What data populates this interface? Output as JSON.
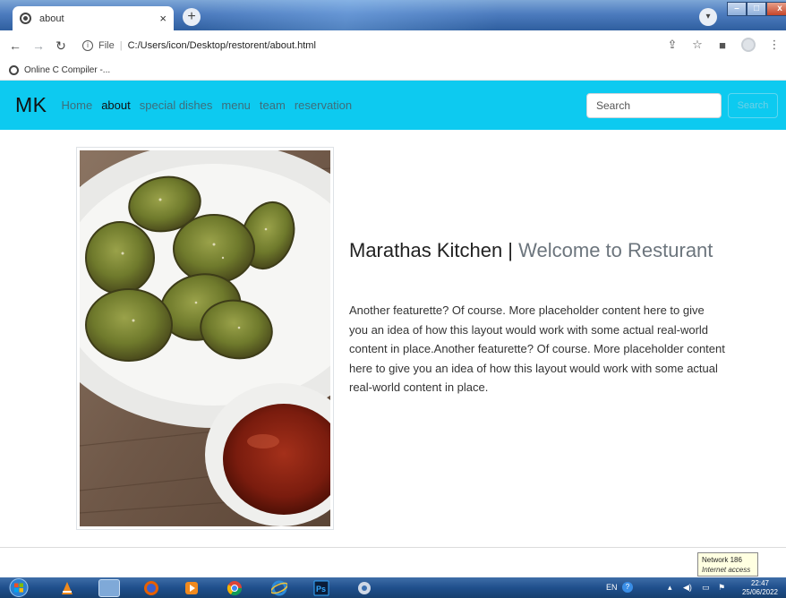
{
  "browser": {
    "tab_title": "about",
    "tab_close": "×",
    "new_tab": "+",
    "url_scheme": "File",
    "url_path": "C:/Users/icon/Desktop/restorent/about.html",
    "bookmark_label": "Online C Compiler -..."
  },
  "navbar": {
    "brand": "MK",
    "links": [
      {
        "label": "Home",
        "active": false
      },
      {
        "label": "about",
        "active": true
      },
      {
        "label": "special dishes",
        "active": false
      },
      {
        "label": "menu",
        "active": false
      },
      {
        "label": "team",
        "active": false
      },
      {
        "label": "reservation",
        "active": false
      }
    ],
    "search_placeholder": "Search",
    "search_button": "Search"
  },
  "featurette": {
    "heading_main": "Marathas Kitchen |",
    "heading_muted": "Welcome to Resturant",
    "lead": "Another featurette? Of course. More placeholder content here to give you an idea of how this layout would work with some actual real-world content in place.Another featurette? Of course. More placeholder content here to give you an idea of how this layout would work with some actual real-world content in place."
  },
  "tooltip": {
    "line1": "Network 186",
    "line2": "Internet access"
  },
  "taskbar": {
    "language": "EN",
    "time": "22:47",
    "date": "25/06/2022"
  },
  "colors": {
    "navbar_bg": "#0dcaf0",
    "taskbar_bg": "#1f4f8c"
  }
}
